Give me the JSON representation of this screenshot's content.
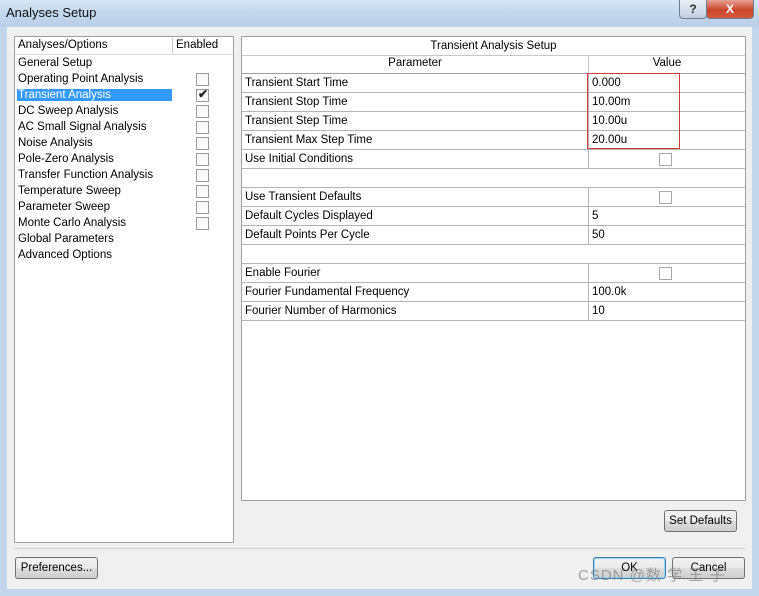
{
  "window": {
    "title": "Analyses Setup",
    "help_glyph": "?",
    "close_glyph": "X"
  },
  "left": {
    "header_name": "Analyses/Options",
    "header_enabled": "Enabled",
    "items": [
      {
        "label": "General Setup",
        "has_checkbox": false,
        "checked": false,
        "selected": false
      },
      {
        "label": "Operating Point Analysis",
        "has_checkbox": true,
        "checked": false,
        "selected": false
      },
      {
        "label": "Transient Analysis",
        "has_checkbox": true,
        "checked": true,
        "selected": true
      },
      {
        "label": "DC Sweep Analysis",
        "has_checkbox": true,
        "checked": false,
        "selected": false
      },
      {
        "label": "AC Small Signal Analysis",
        "has_checkbox": true,
        "checked": false,
        "selected": false
      },
      {
        "label": "Noise Analysis",
        "has_checkbox": true,
        "checked": false,
        "selected": false
      },
      {
        "label": "Pole-Zero Analysis",
        "has_checkbox": true,
        "checked": false,
        "selected": false
      },
      {
        "label": "Transfer Function Analysis",
        "has_checkbox": true,
        "checked": false,
        "selected": false
      },
      {
        "label": "Temperature Sweep",
        "has_checkbox": true,
        "checked": false,
        "selected": false
      },
      {
        "label": "Parameter Sweep",
        "has_checkbox": true,
        "checked": false,
        "selected": false
      },
      {
        "label": "Monte Carlo Analysis",
        "has_checkbox": true,
        "checked": false,
        "selected": false
      },
      {
        "label": "Global Parameters",
        "has_checkbox": false,
        "checked": false,
        "selected": false
      },
      {
        "label": "Advanced Options",
        "has_checkbox": false,
        "checked": false,
        "selected": false
      }
    ]
  },
  "right": {
    "title": "Transient Analysis Setup",
    "col_parameter": "Parameter",
    "col_value": "Value",
    "rows": [
      {
        "param": "Transient Start Time",
        "value": "0.000",
        "kind": "text"
      },
      {
        "param": "Transient Stop Time",
        "value": "10.00m",
        "kind": "text"
      },
      {
        "param": "Transient Step Time",
        "value": "10.00u",
        "kind": "text"
      },
      {
        "param": "Transient Max Step Time",
        "value": "20.00u",
        "kind": "text"
      },
      {
        "param": "Use Initial Conditions",
        "value": "",
        "kind": "checkbox"
      },
      {
        "param": "",
        "value": "",
        "kind": "blank"
      },
      {
        "param": "Use Transient Defaults",
        "value": "",
        "kind": "checkbox"
      },
      {
        "param": "Default Cycles Displayed",
        "value": "5",
        "kind": "text"
      },
      {
        "param": "Default Points Per Cycle",
        "value": "50",
        "kind": "text"
      },
      {
        "param": "",
        "value": "",
        "kind": "blank"
      },
      {
        "param": "Enable Fourier",
        "value": "",
        "kind": "checkbox"
      },
      {
        "param": "Fourier Fundamental Frequency",
        "value": "100.0k",
        "kind": "text"
      },
      {
        "param": "Fourier Number of Harmonics",
        "value": "10",
        "kind": "text"
      }
    ]
  },
  "buttons": {
    "set_defaults": "Set Defaults",
    "preferences": "Preferences...",
    "ok": "OK",
    "cancel": "Cancel"
  },
  "watermark": "CSDN @数 学 王 子"
}
